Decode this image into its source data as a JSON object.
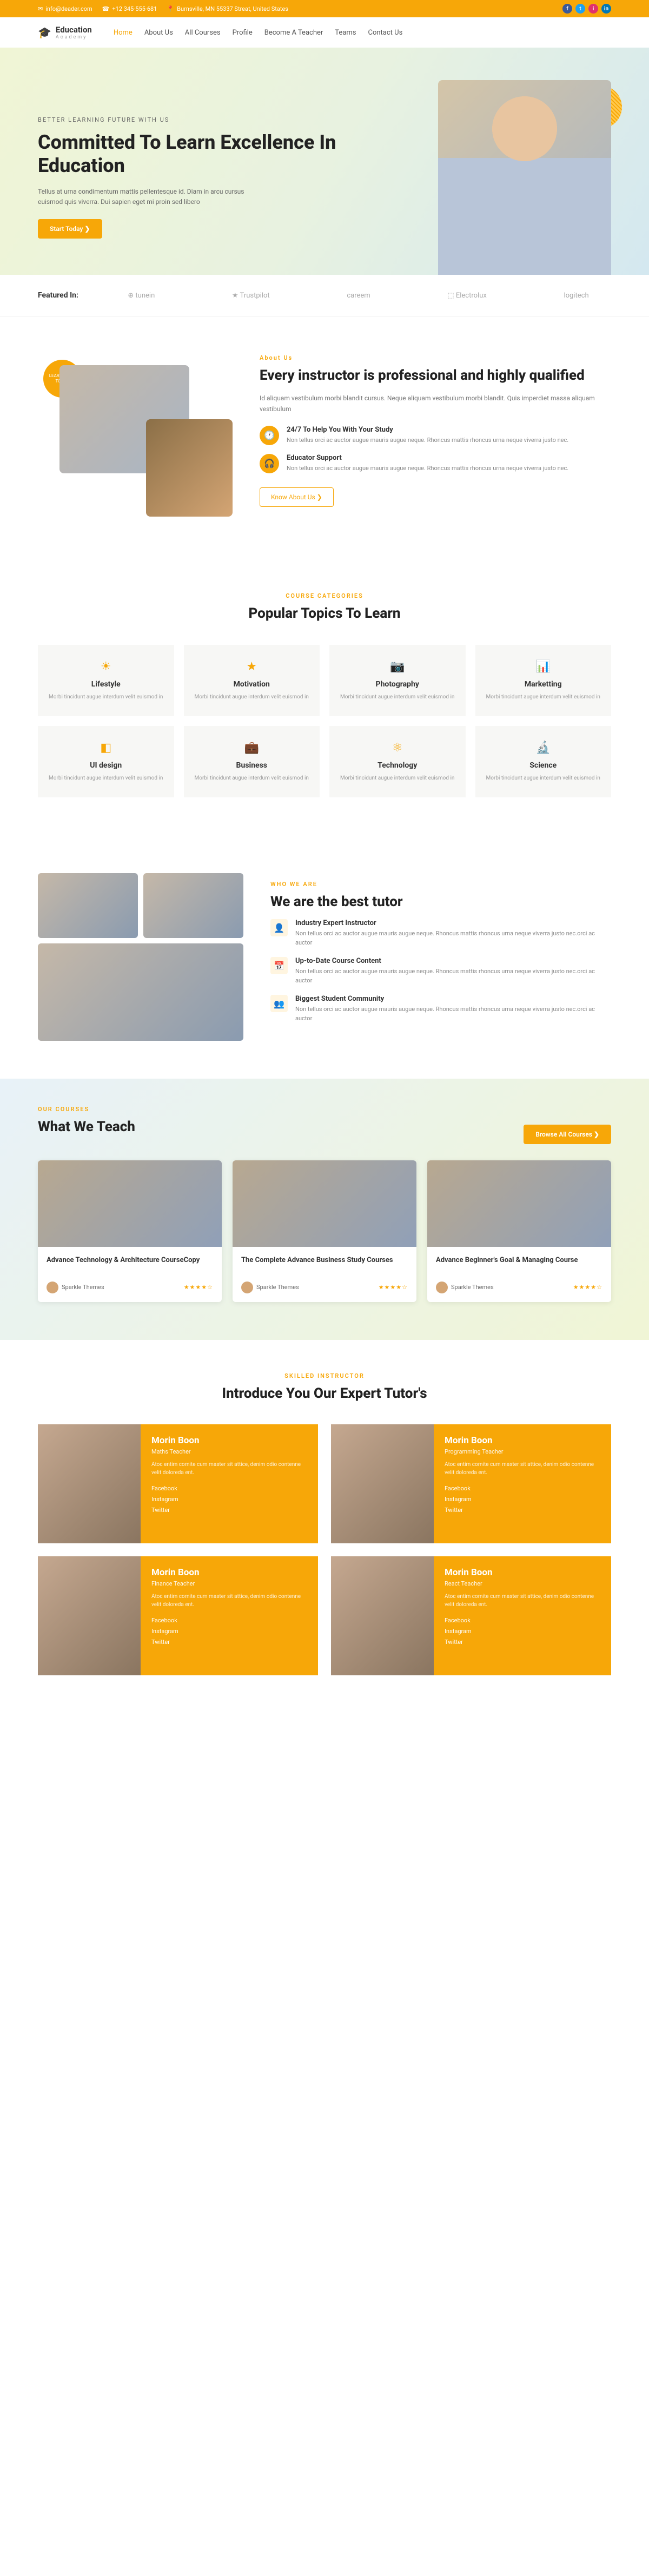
{
  "topbar": {
    "email": "info@deader.com",
    "phone": "+12 345-555-681",
    "address": "Burnsville, MN 55337 Streat, United States"
  },
  "social": [
    "f",
    "t",
    "i",
    "in"
  ],
  "logo": {
    "main": "Education",
    "sub": "Academy"
  },
  "nav": [
    "Home",
    "About Us",
    "All Courses",
    "Profile",
    "Become A Teacher",
    "Teams",
    "Contact Us"
  ],
  "hero": {
    "tag": "BETTER LEARNING FUTURE WITH US",
    "title": "Committed To Learn Excellence In Education",
    "desc": "Tellus at urna condimentum mattis pellentesque id. Diam in arcu cursus euismod quis viverra. Dui sapien eget mi proin sed libero",
    "btn": "Start Today ❯"
  },
  "featured": {
    "label": "Featured In:",
    "logos": [
      "⊕ tunein",
      "★ Trustpilot",
      "careem",
      "⬚ Electrolux",
      "logitech"
    ]
  },
  "about": {
    "tag": "About Us",
    "title": "Every instructor is professional and highly qualified",
    "desc": "Id aliquam vestibulum morbi blandit cursus. Neque aliquam vestibulum morbi blandit. Quis imperdiet massa aliquam vestibulum",
    "features": [
      {
        "icon": "🕐",
        "title": "24/7 To Help You With Your Study",
        "desc": "Non tellus orci ac auctor augue mauris augue neque. Rhoncus mattis rhoncus urna neque viverra justo nec."
      },
      {
        "icon": "🎧",
        "title": "Educator Support",
        "desc": "Non tellus orci ac auctor augue mauris augue neque. Rhoncus mattis rhoncus urna neque viverra justo nec."
      }
    ],
    "btn": "Know About Us ❯",
    "badge": "LEARN FROM TODAY"
  },
  "categories": {
    "tag": "COURSE CATEGORIES",
    "title": "Popular Topics To Learn",
    "items": [
      {
        "icon": "☀",
        "title": "Lifestyle",
        "desc": "Morbi tincidunt augue interdum velit euismod in"
      },
      {
        "icon": "★",
        "title": "Motivation",
        "desc": "Morbi tincidunt augue interdum velit euismod in"
      },
      {
        "icon": "📷",
        "title": "Photography",
        "desc": "Morbi tincidunt augue interdum velit euismod in"
      },
      {
        "icon": "📊",
        "title": "Marketting",
        "desc": "Morbi tincidunt augue interdum velit euismod in"
      },
      {
        "icon": "◧",
        "title": "UI design",
        "desc": "Morbi tincidunt augue interdum velit euismod in"
      },
      {
        "icon": "💼",
        "title": "Business",
        "desc": "Morbi tincidunt augue interdum velit euismod in"
      },
      {
        "icon": "⚛",
        "title": "Technology",
        "desc": "Morbi tincidunt augue interdum velit euismod in"
      },
      {
        "icon": "🔬",
        "title": "Science",
        "desc": "Morbi tincidunt augue interdum velit euismod in"
      }
    ]
  },
  "who": {
    "tag": "WHO WE ARE",
    "title": "We are the best tutor",
    "items": [
      {
        "icon": "👤",
        "title": "Industry Expert Instructor",
        "desc": "Non tellus orci ac auctor augue mauris augue neque. Rhoncus mattis rhoncus urna neque viverra justo nec.orci ac auctor"
      },
      {
        "icon": "📅",
        "title": "Up-to-Date Course Content",
        "desc": "Non tellus orci ac auctor augue mauris augue neque. Rhoncus mattis rhoncus urna neque viverra justo nec.orci ac auctor"
      },
      {
        "icon": "👥",
        "title": "Biggest Student Community",
        "desc": "Non tellus orci ac auctor augue mauris augue neque. Rhoncus mattis rhoncus urna neque viverra justo nec.orci ac auctor"
      }
    ]
  },
  "courses": {
    "tag": "OUR COURSES",
    "title": "What We Teach",
    "btn": "Browse All Courses ❯",
    "items": [
      {
        "title": "Advance Technology & Architecture CourseCopy",
        "author": "Sparkle Themes",
        "stars": "★★★★☆"
      },
      {
        "title": "The Complete Advance Business Study Courses",
        "author": "Sparkle Themes",
        "stars": "★★★★☆"
      },
      {
        "title": "Advance Beginner's Goal & Managing Course",
        "author": "Sparkle Themes",
        "stars": "★★★★☆"
      }
    ]
  },
  "instructors": {
    "tag": "SKILLED INSTRUCTOR",
    "title": "Introduce You Our Expert Tutor's",
    "items": [
      {
        "name": "Morin Boon",
        "role": "Maths Teacher",
        "bio": "Atoc entim comite cum master sit attice, denim odio contenne velit doloreda ent."
      },
      {
        "name": "Morin Boon",
        "role": "Programming Teacher",
        "bio": "Atoc entim comite cum master sit attice, denim odio contenne velit doloreda ent."
      },
      {
        "name": "Morin Boon",
        "role": "Finance Teacher",
        "bio": "Atoc entim comite cum master sit attice, denim odio contenne velit doloreda ent."
      },
      {
        "name": "Morin Boon",
        "role": "React Teacher",
        "bio": "Atoc entim comite cum master sit attice, denim odio contenne velit doloreda ent."
      }
    ],
    "links": [
      "Facebook",
      "Instagram",
      "Twitter"
    ]
  }
}
